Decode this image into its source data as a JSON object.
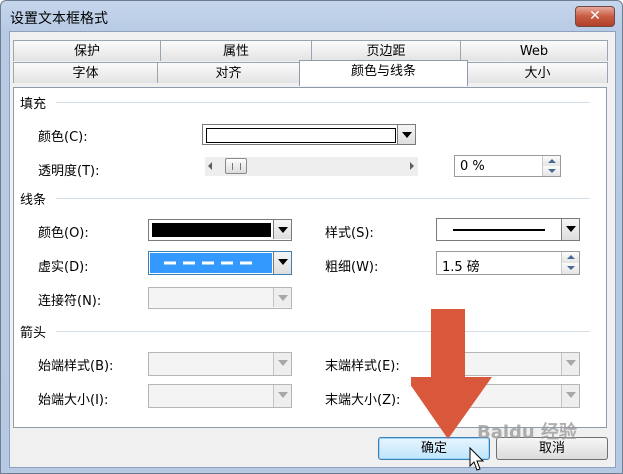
{
  "window": {
    "title": "设置文本框格式",
    "close_symbol": "✕"
  },
  "tabs": {
    "back_row": [
      "保护",
      "属性",
      "页边距",
      "Web"
    ],
    "front_row": [
      "字体",
      "对齐",
      "颜色与线条",
      "大小"
    ],
    "active": "颜色与线条"
  },
  "fill": {
    "section": "填充",
    "color_label": "颜色(C):",
    "color_value": "#ffffff",
    "transparency_label": "透明度(T):",
    "transparency_value": "0 %"
  },
  "line": {
    "section": "线条",
    "color_label": "颜色(O):",
    "color_value": "#000000",
    "style_label": "样式(S):",
    "dash_label": "虚实(D):",
    "weight_label": "粗细(W):",
    "weight_value": "1.5 磅",
    "connector_label": "连接符(N):"
  },
  "arrows": {
    "section": "箭头",
    "begin_style_label": "始端样式(B):",
    "end_style_label": "末端样式(E):",
    "begin_size_label": "始端大小(I):",
    "end_size_label": "末端大小(Z):"
  },
  "buttons": {
    "ok": "确定",
    "cancel": "取消"
  },
  "watermark": "Baidu 经验",
  "colors": {
    "annotation_arrow": "#d9573b",
    "selected_highlight": "#3399ff"
  }
}
